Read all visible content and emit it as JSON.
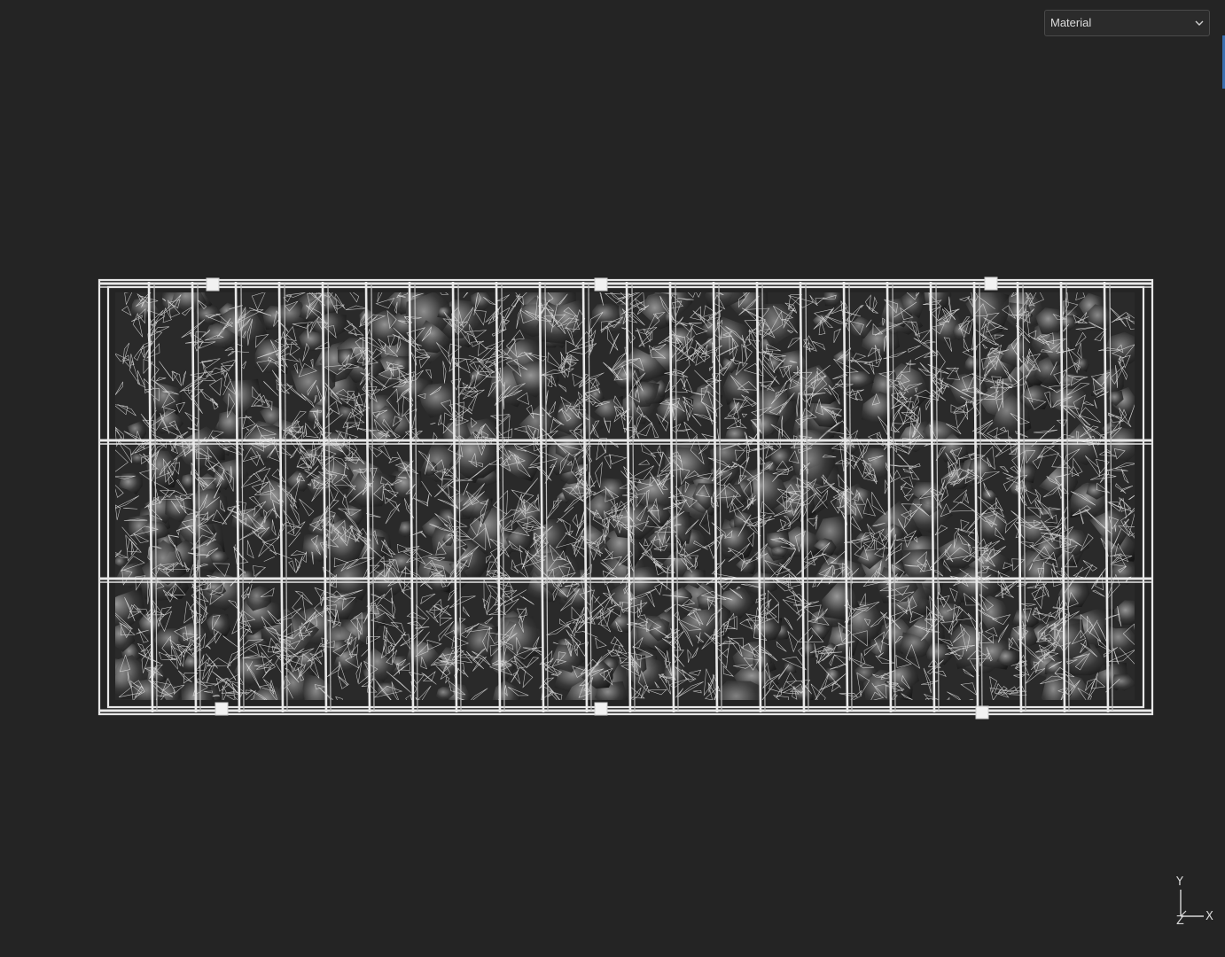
{
  "toolbar": {
    "shading_mode": "Material",
    "dropdown_icon": "chevron-down-icon"
  },
  "scene": {
    "model": "gabion-cage-with-stones",
    "display": "wireframe-over-material",
    "colors": {
      "background": "#242424",
      "wire": "#e8e8e8",
      "stone_dark": "#1a1a1a",
      "stone_light": "#8a8a8a"
    }
  },
  "axis_gizmo": {
    "y_label": "Y",
    "z_label": "Z",
    "x_label": "X"
  }
}
